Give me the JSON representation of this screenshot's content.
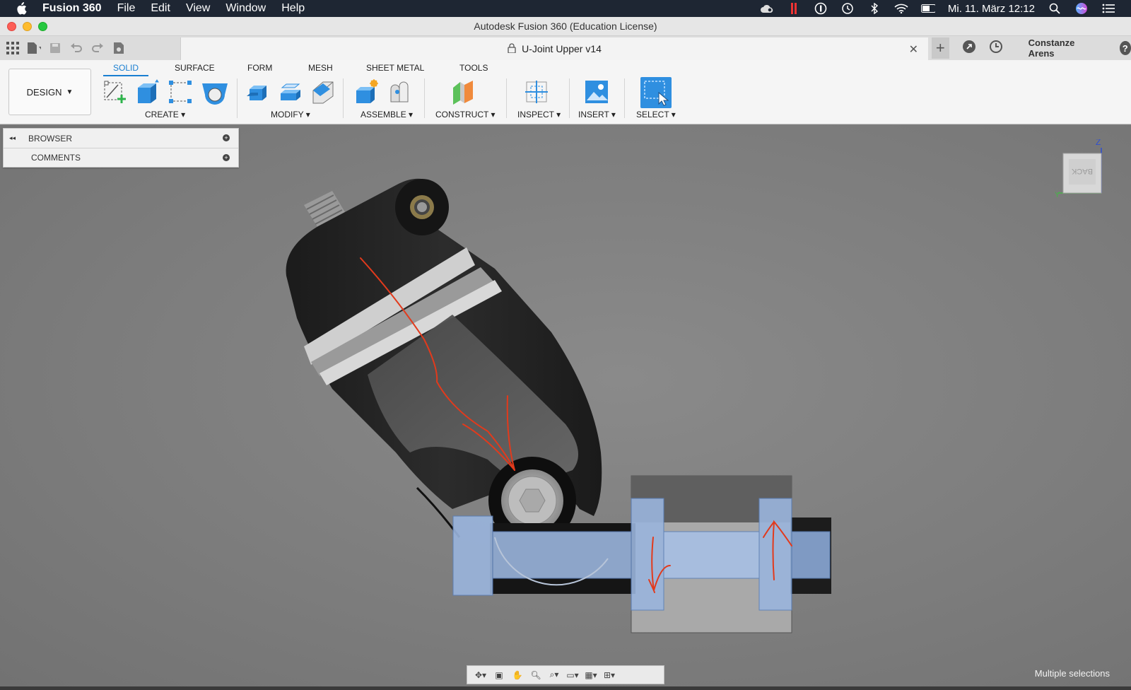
{
  "menubar": {
    "app_name": "Fusion 360",
    "items": [
      "File",
      "Edit",
      "View",
      "Window",
      "Help"
    ],
    "clock": "Mi. 11. März  12:12",
    "icons": [
      "creative-cloud-icon",
      "pause-icon",
      "1password-icon",
      "time-machine-icon",
      "bluetooth-icon",
      "wifi-icon",
      "battery-icon",
      "search-icon",
      "siri-icon",
      "notification-center-icon"
    ]
  },
  "window": {
    "title": "Autodesk Fusion 360 (Education License)"
  },
  "document": {
    "tab_title": "U-Joint Upper v14",
    "user": "Constanze Arens",
    "help": "?"
  },
  "ribbon": {
    "workspace": "DESIGN",
    "tabs": [
      "SOLID",
      "SURFACE",
      "FORM",
      "MESH",
      "SHEET METAL",
      "TOOLS"
    ],
    "active_tab": "SOLID",
    "groups": [
      "CREATE",
      "MODIFY",
      "ASSEMBLE",
      "CONSTRUCT",
      "INSPECT",
      "INSERT",
      "SELECT"
    ],
    "accent_color": "#1a7fd1"
  },
  "browser": {
    "items": [
      "BROWSER",
      "COMMENTS"
    ]
  },
  "viewcube": {
    "face": "BACK",
    "axis_z": "Z",
    "axis_y": "Y"
  },
  "status": {
    "text": "Multiple selections"
  }
}
